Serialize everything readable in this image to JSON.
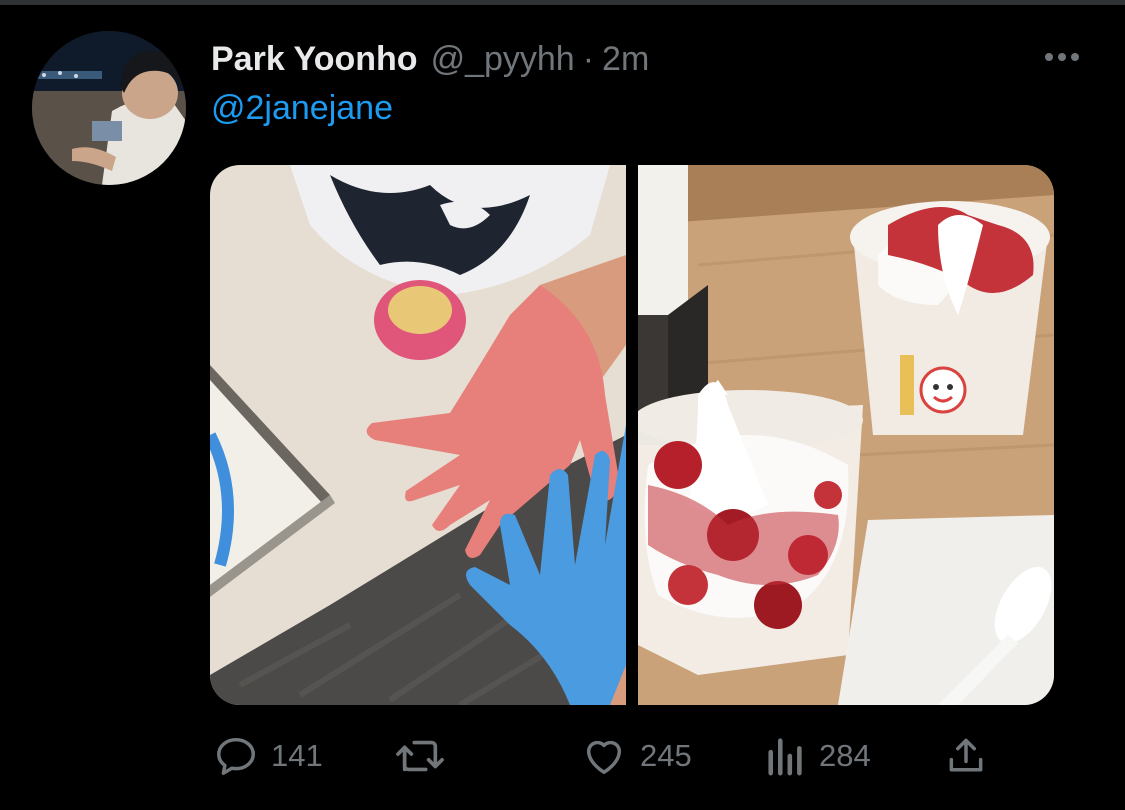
{
  "tweet": {
    "display_name": "Park Yoonho",
    "handle": "@_pyyhh",
    "separator": "·",
    "time": "2m",
    "text_mention": "@2janejane"
  },
  "media": {
    "photos": [
      {
        "subject": "painted hands"
      },
      {
        "subject": "strawberry sundaes"
      }
    ]
  },
  "actions": {
    "reply_count": "141",
    "retweet_count": "",
    "like_count": "245",
    "views_count": "284"
  },
  "icons": {
    "more": "more-icon",
    "reply": "reply-icon",
    "retweet": "retweet-icon",
    "like": "heart-icon",
    "views": "views-icon",
    "share": "share-icon"
  },
  "colors": {
    "background": "#000000",
    "text_primary": "#e7e9ea",
    "text_secondary": "#71767b",
    "accent": "#1d9bf0"
  }
}
